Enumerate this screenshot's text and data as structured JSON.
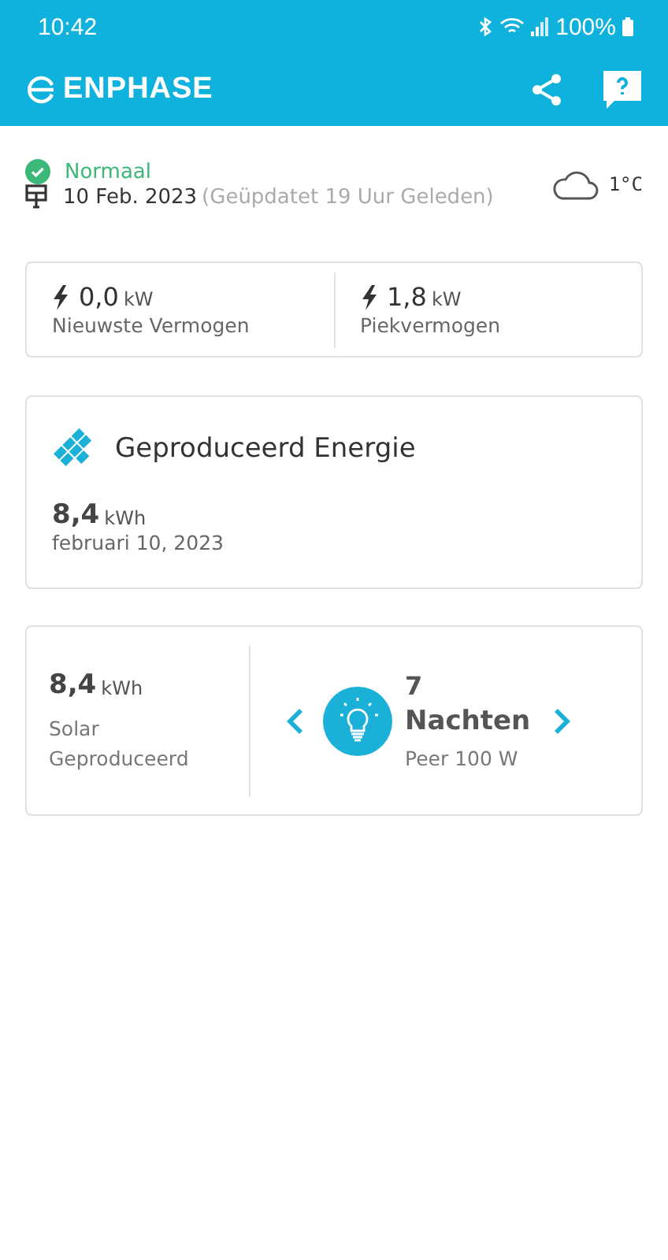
{
  "status_bar": {
    "time": "10:42",
    "battery": "100%"
  },
  "app_bar": {
    "logo": "ENPHASE"
  },
  "system": {
    "status": "Normaal",
    "date": "10 Feb. 2023",
    "updated": "(Geüpdatet 19 Uur Geleden)",
    "temperature": "1°C"
  },
  "power": [
    {
      "value": "0,0",
      "unit": "kW",
      "label": "Nieuwste Vermogen"
    },
    {
      "value": "1,8",
      "unit": "kW",
      "label": "Piekvermogen"
    }
  ],
  "energy": {
    "title": "Geproduceerd Energie",
    "value": "8,4",
    "unit": "kWh",
    "date": "februari 10, 2023"
  },
  "equivalent": {
    "value": "8,4",
    "unit": "kWh",
    "label": "Solar Geproduceerd",
    "count": "7",
    "period": "Nachten",
    "device": "Peer 100 W"
  }
}
